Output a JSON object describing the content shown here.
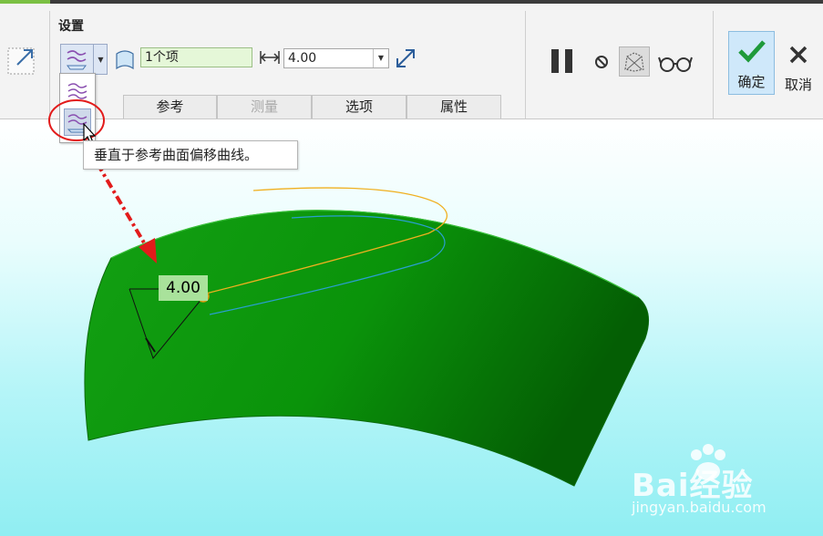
{
  "ribbon": {
    "group_label": "设置",
    "reference_field": "1个项",
    "offset_value": "4.00",
    "tabs": [
      {
        "label": "参考",
        "enabled": true
      },
      {
        "label": "测量",
        "enabled": false
      },
      {
        "label": "选项",
        "enabled": true
      },
      {
        "label": "属性",
        "enabled": true
      }
    ],
    "ok_label": "确定",
    "cancel_label": "取消"
  },
  "tooltip": {
    "text": "垂直于参考曲面偏移曲线。"
  },
  "viewport": {
    "dimension_value": "4.00",
    "surface_color": "#0a8c0a",
    "curve_color": "#f0b020",
    "offset_curve_color": "#2a9fd0"
  },
  "watermark": {
    "main": "Bai经验",
    "sub": "jingyan.baidu.com"
  },
  "icons": [
    "expand-corner-icon",
    "offset-type-icon",
    "surface-quilt-icon",
    "distance-icon",
    "flip-direction-icon",
    "pause-icon",
    "no-preview-icon",
    "geometry-preview-icon",
    "glasses-preview-icon",
    "checkmark-icon",
    "close-x-icon"
  ]
}
